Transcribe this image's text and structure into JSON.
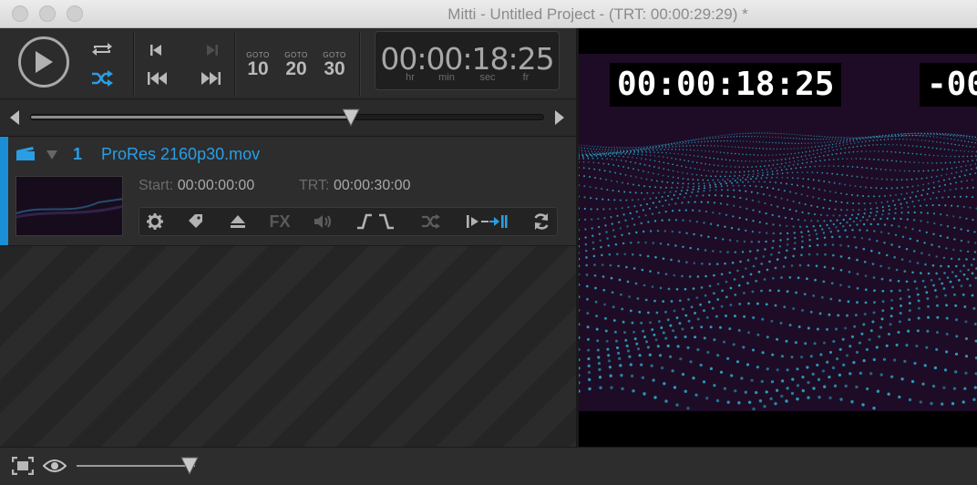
{
  "window": {
    "title": "Mitti - Untitled Project - (TRT: 00:00:29:29) *"
  },
  "transport": {
    "goto": [
      {
        "label": "GOTO",
        "value": "10"
      },
      {
        "label": "GOTO",
        "value": "20"
      },
      {
        "label": "GOTO",
        "value": "30"
      }
    ],
    "timecode": "00:00:18:25",
    "units": [
      "hr",
      "min",
      "sec",
      "fr"
    ]
  },
  "scrubber": {
    "position": 0.624
  },
  "playlist": {
    "clips": [
      {
        "number": "1",
        "name": "ProRes 2160p30.mov",
        "start_label": "Start:",
        "start_value": "00:00:00:00",
        "trt_label": "TRT:",
        "trt_value": "00:00:30:00",
        "tools": [
          "gear-icon",
          "tag-icon",
          "eject-icon",
          "FX",
          "volume-icon",
          "fade-icon",
          "shuffle-icon",
          "cue-icon",
          "loop-icon"
        ]
      }
    ]
  },
  "preview": {
    "timecode": "00:00:18:25",
    "countdown": "-00"
  },
  "bottom_bar": {
    "zoom_position": 0.95
  },
  "colors": {
    "accent": "#1a8fd6",
    "text_blue": "#2a9ee4",
    "wave_cyan": "#2bb8d8",
    "wave_bg": "#1e0c26"
  }
}
